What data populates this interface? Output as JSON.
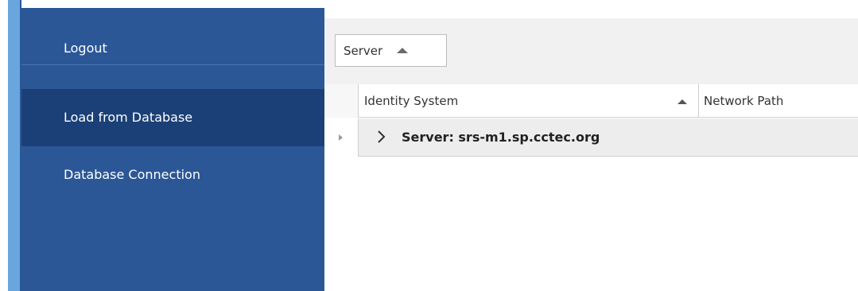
{
  "sidebar": {
    "items": [
      {
        "label": "Logout"
      },
      {
        "label": "Load from Database"
      },
      {
        "label": "Database Connection"
      }
    ],
    "selected": "Load from Database"
  },
  "group_panel": {
    "group_by_label": "Server"
  },
  "grid": {
    "columns": [
      {
        "label": "Identity System",
        "sorted": "ascending"
      },
      {
        "label": "Network Path"
      }
    ],
    "groups": [
      {
        "label": "Server: srs-m1.sp.cctec.org",
        "expanded": false
      }
    ]
  },
  "colors": {
    "sidebar_bg": "#2b5797",
    "sidebar_selected_bg": "#1b4077",
    "accent_strip": "#6aa6de",
    "group_row_bg": "#ededed"
  },
  "icons": {
    "sort": "triangle-up-icon",
    "expander": "chevron-right-icon",
    "row_indicator": "triangle-right-icon"
  }
}
